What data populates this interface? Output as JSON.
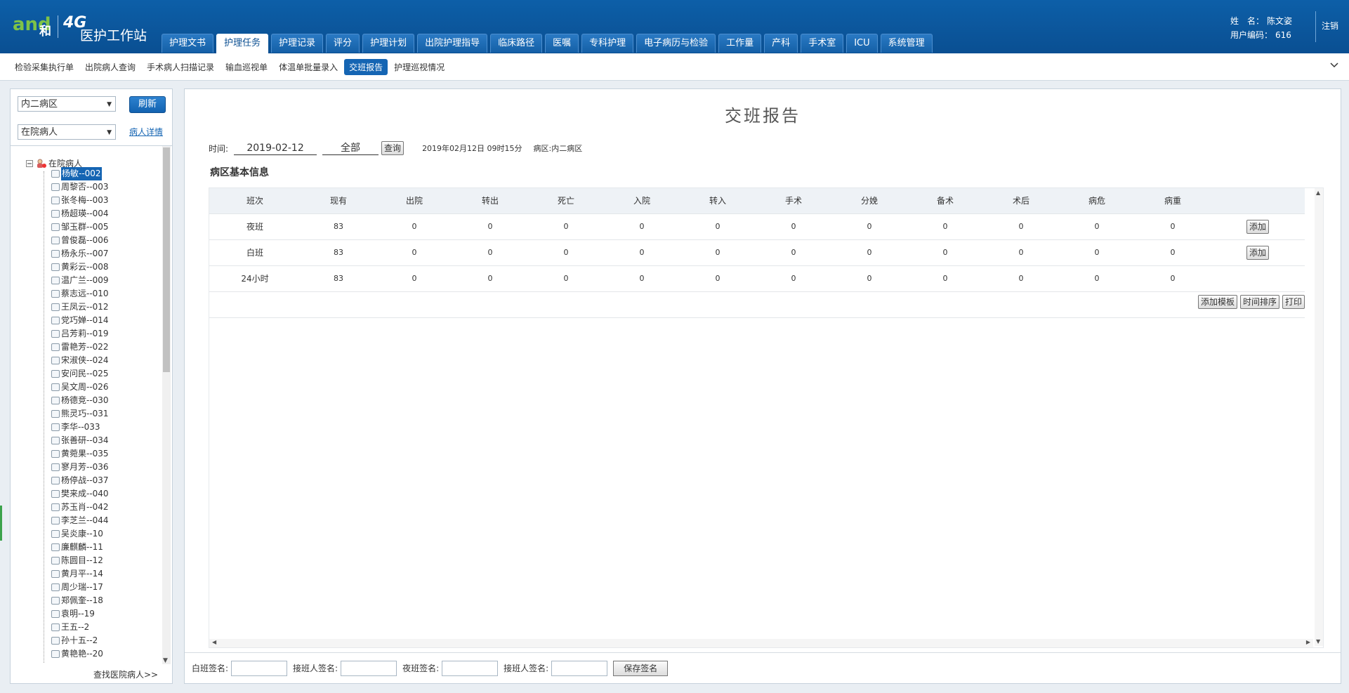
{
  "header": {
    "logo_and": "and",
    "logo_he": "和",
    "logo_4g": "4G",
    "app_title": "医护工作站",
    "tabs": [
      "护理文书",
      "护理任务",
      "护理记录",
      "评分",
      "护理计划",
      "出院护理指导",
      "临床路径",
      "医嘱",
      "专科护理",
      "电子病历与检验",
      "工作量",
      "产科",
      "手术室",
      "ICU",
      "系统管理"
    ],
    "active_tab": "护理任务",
    "user_name_label": "姓　名：",
    "user_name": "陈文姿",
    "user_code_label": "用户编码：",
    "user_code": "616",
    "logout": "注销"
  },
  "subnav": {
    "items": [
      "检验采集执行单",
      "出院病人查询",
      "手术病人扫描记录",
      "输血巡视单",
      "体温单批量录入",
      "交班报告",
      "护理巡视情况"
    ],
    "active": "交班报告"
  },
  "left": {
    "ward_select": "内二病区",
    "refresh": "刷新",
    "patient_filter": "在院病人",
    "patient_detail_link": "病人详情",
    "tree_root": "在院病人",
    "patients": [
      "杨敏--002",
      "周黎否--003",
      "张冬梅--003",
      "杨超瑛--004",
      "邹玉群--005",
      "曾俊磊--006",
      "杨永乐--007",
      "黄彩云--008",
      "温广兰--009",
      "蔡志远--010",
      "王凤云--012",
      "党巧婵--014",
      "吕芳莉--019",
      "雷艳芳--022",
      "宋淑侠--024",
      "安问民--025",
      "吴文周--026",
      "杨德竞--030",
      "熊灵巧--031",
      "李华--033",
      "张善研--034",
      "黄菀果--035",
      "寥月芳--036",
      "杨停战--037",
      "樊来成--040",
      "苏玉肖--042",
      "李芝兰--044",
      "吴炎康--10",
      "廉麒麟--11",
      "陈圆目--12",
      "黄月平--14",
      "周少瑞--17",
      "郑佩奎--18",
      "袁明--19",
      "王五--2",
      "孙十五--2",
      "黄艳艳--20"
    ],
    "selected_patient": "杨敏--002",
    "find_link": "查找医院病人>>"
  },
  "main": {
    "title": "交班报告",
    "time_label": "时间:",
    "date": "2019-02-12",
    "shift_select": "全部",
    "query_button": "查询",
    "datetime_info": "2019年02月12日 09时15分",
    "ward_info": "病区:内二病区",
    "section_title": "病区基本信息",
    "columns": [
      "班次",
      "现有",
      "出院",
      "转出",
      "死亡",
      "入院",
      "转入",
      "手术",
      "分娩",
      "备术",
      "术后",
      "病危",
      "病重"
    ],
    "rows": [
      {
        "shift": "夜班",
        "values": [
          "83",
          "0",
          "0",
          "0",
          "0",
          "0",
          "0",
          "0",
          "0",
          "0",
          "0",
          "0"
        ],
        "action": "添加"
      },
      {
        "shift": "白班",
        "values": [
          "83",
          "0",
          "0",
          "0",
          "0",
          "0",
          "0",
          "0",
          "0",
          "0",
          "0",
          "0"
        ],
        "action": "添加"
      },
      {
        "shift": "24小时",
        "values": [
          "83",
          "0",
          "0",
          "0",
          "0",
          "0",
          "0",
          "0",
          "0",
          "0",
          "0",
          "0"
        ],
        "action": ""
      }
    ],
    "add_template": "添加模板",
    "time_sort": "时间排序",
    "print": "打印",
    "day_sign_label": "白班签名:",
    "receiver_sign_label": "接班人签名:",
    "night_sign_label": "夜班签名:",
    "receiver_sign_label2": "接班人签名:",
    "save_sign": "保存签名"
  },
  "colors": {
    "header_bg": "#0d5fa8",
    "accent": "#1565b3"
  }
}
